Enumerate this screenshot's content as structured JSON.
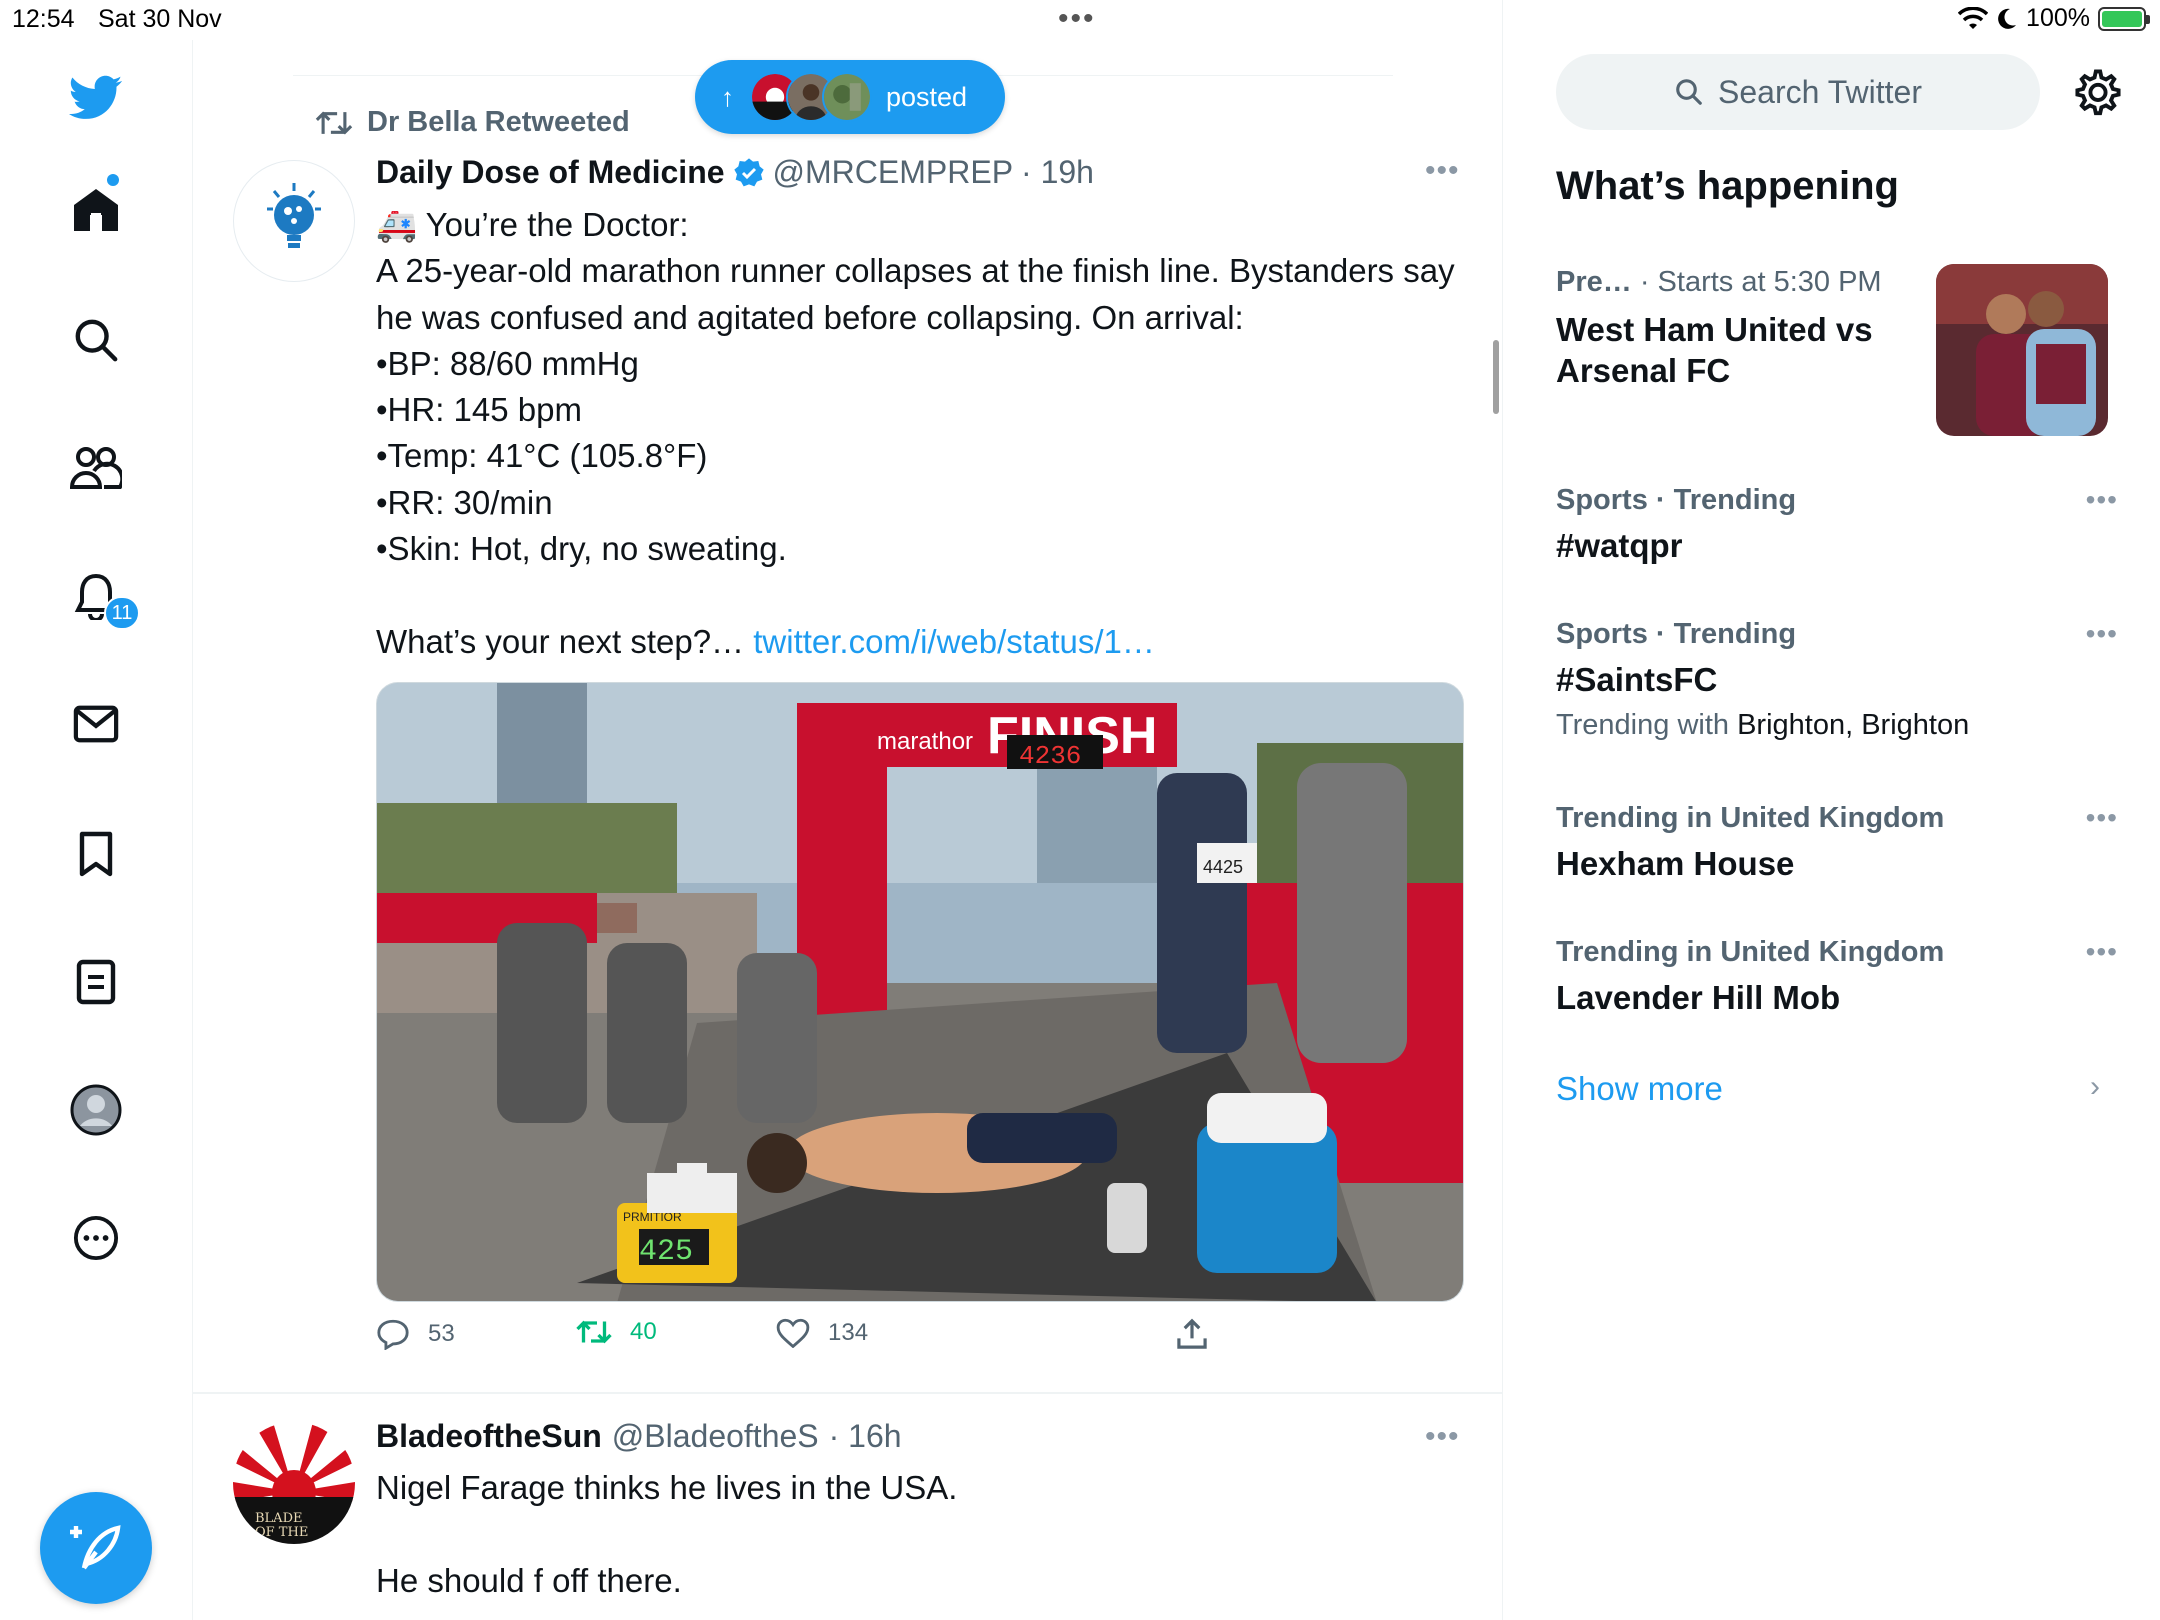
{
  "status_bar": {
    "time": "12:54",
    "date": "Sat 30 Nov",
    "battery": "100%"
  },
  "nav": {
    "notifications_badge": "11"
  },
  "new_posts_pill": {
    "label": "posted"
  },
  "tweet1": {
    "retweeted_by": "Dr Bella Retweeted",
    "name": "Daily Dose of Medicine",
    "handle": "@MRCEMPREP",
    "time": "· 19h",
    "body_lines": "🚑 You’re the Doctor:\nA 25-year-old marathon runner collapses at the finish line. Bystanders say he was confused and agitated before collapsing. On arrival:\n•BP: 88/60 mmHg\n•HR: 145 bpm\n•Temp: 41°C (105.8°F)\n•RR: 30/min\n•Skin: Hot, dry, no sweating.\n\nWhat’s your next step?… ",
    "link_text": "twitter.com/i/web/status/1…",
    "image_text": {
      "banner": "FINISH",
      "brand": "marathor",
      "timer": "4236",
      "monitor": "425",
      "monitor_brand": "PRMITIOR",
      "bib": "4425"
    },
    "replies": "53",
    "retweets": "40",
    "likes": "134"
  },
  "tweet2": {
    "name": "BladeoftheSun",
    "handle": "@BladeoftheS",
    "time": "· 16h",
    "body": "Nigel Farage thinks he lives in the USA.\n\nHe should f off there."
  },
  "sidebar": {
    "search_placeholder": "Search Twitter",
    "heading": "What’s happening",
    "event": {
      "category": "Pre…",
      "time": "· Starts at 5:30 PM",
      "title": "West Ham United vs Arsenal FC"
    },
    "trends": [
      {
        "meta": "Sports · Trending",
        "title": "#watqpr"
      },
      {
        "meta": "Sports · Trending",
        "title": "#SaintsFC",
        "sub_prefix": "Trending with ",
        "sub_names": "Brighton, Brighton"
      },
      {
        "meta": "Trending in United Kingdom",
        "title": "Hexham House"
      },
      {
        "meta": "Trending in United Kingdom",
        "title": "Lavender Hill Mob"
      }
    ],
    "show_more": "Show more"
  },
  "colors": {
    "accent": "#1d9bf0",
    "retweet_green": "#00ba7c",
    "secondary_text": "#536471"
  }
}
